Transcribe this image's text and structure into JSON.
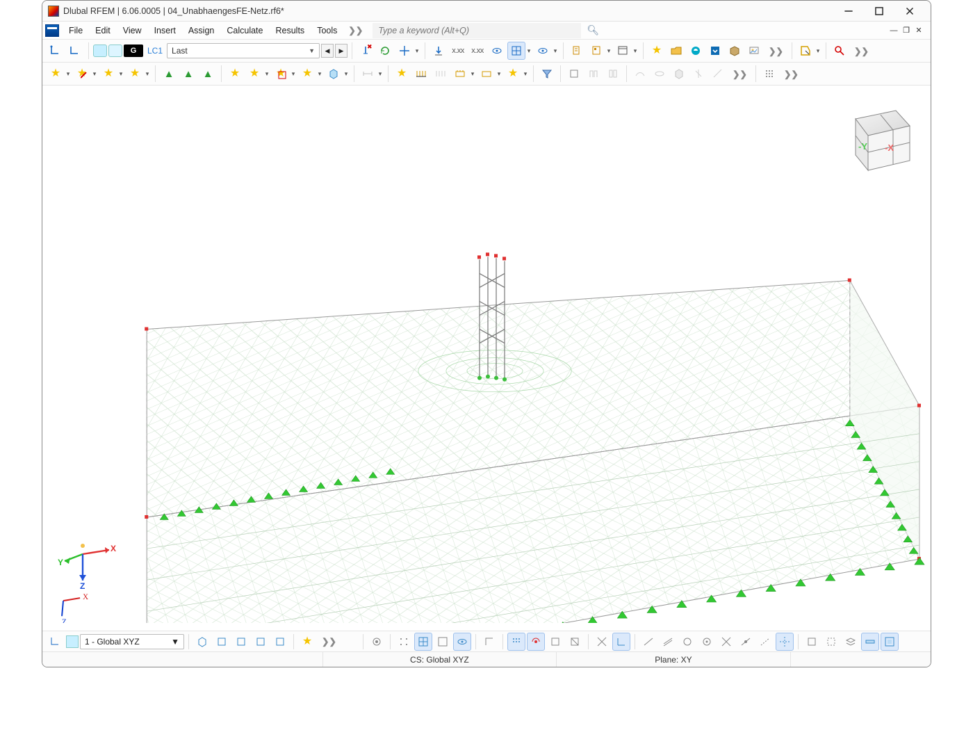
{
  "titlebar": {
    "text": "Dlubal RFEM | 6.06.0005 | 04_UnabhaengesFE-Netz.rf6*"
  },
  "menu": {
    "items": [
      "File",
      "Edit",
      "View",
      "Insert",
      "Assign",
      "Calculate",
      "Results",
      "Tools"
    ],
    "more": "❯❯",
    "search_placeholder": "Type a keyword (Alt+Q)"
  },
  "toolbar1": {
    "g_badge": "G",
    "lc_label": "LC1",
    "case_combo": "Last",
    "nav_prev": "◀",
    "nav_next": "▶",
    "xxx_labels": [
      "x.xx",
      "x.xx"
    ],
    "more": "❯❯"
  },
  "toolbar2": {
    "more": "❯❯"
  },
  "viewport": {
    "axis_labels": {
      "x": "X",
      "y": "Y",
      "z": "Z"
    },
    "navcube_faces": {
      "right": "-X",
      "front": "-Y"
    }
  },
  "bottom": {
    "ws_combo": "1 - Global XYZ",
    "more": "❯❯"
  },
  "status": {
    "left": "",
    "cs": "CS: Global XYZ",
    "plane": "Plane: XY",
    "right": ""
  },
  "icons": {
    "minimize": "minimize-icon",
    "maximize": "maximize-icon",
    "close": "close-icon",
    "search": "search-icon",
    "restore": "restore-icon",
    "mdi-close": "mdi-close-icon"
  }
}
